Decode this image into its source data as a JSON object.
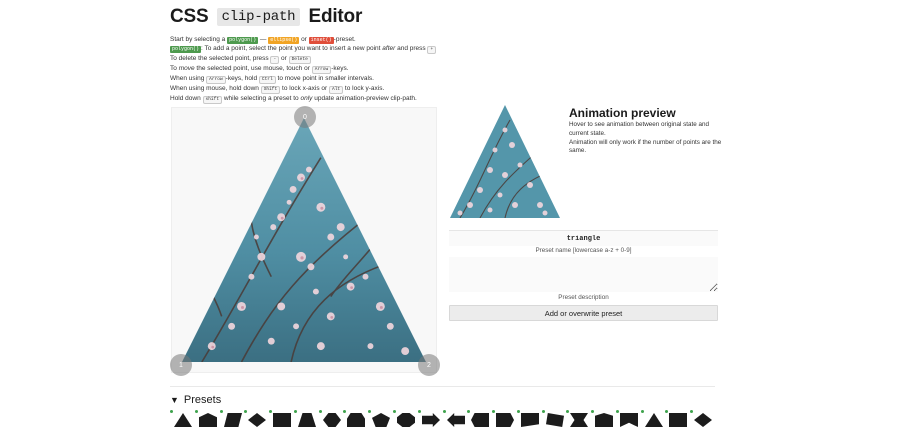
{
  "header": {
    "title_pre": "CSS",
    "title_code": "clip-path",
    "title_post": "Editor"
  },
  "instructions": {
    "l1_a": "Start by selecting a",
    "tag_polygon": "polygon()",
    "l1_b": "—",
    "tag_ellipse": "ellipse()",
    "l1_c": "or",
    "tag_inset": "inset()",
    "l1_d": "-preset.",
    "l2_tag": "polygon()",
    "l2_a": ": To add a point, select the point you want to insert a new point",
    "l2_em": "after",
    "l2_b": "and press",
    "l2_key": "+",
    "l3_a": "To delete the selected point, press",
    "l3_key1": "-",
    "l3_b": "or",
    "l3_key2": "Delete",
    "l4_a": "To",
    "l4_em": "move",
    "l4_b": "the selected point, use mouse, touch or",
    "l4_key": "Arrow",
    "l4_c": "-keys.",
    "l5_a": "When using",
    "l5_key1": "Arrow",
    "l5_b": "-keys, hold",
    "l5_key2": "Ctrl",
    "l5_c": "to move point in smaller intervals.",
    "l6_a": "When using mouse, hold down",
    "l6_key1": "Shift",
    "l6_b": "to lock x-axis or",
    "l6_key2": "Alt",
    "l6_c": "to lock y-axis.",
    "l7_a": "Hold down",
    "l7_key": "shift",
    "l7_b": "while selecting a preset to",
    "l7_em": "only",
    "l7_c": "update animation-preview clip-path."
  },
  "editor": {
    "handles": [
      "0",
      "1",
      "2"
    ]
  },
  "animation": {
    "title": "Animation preview",
    "desc1": "Hover to see animation between original state and current state.",
    "desc2": "Animation will only work if the number of points are the same."
  },
  "form": {
    "preset_name_value": "triangle",
    "preset_name_label": "Preset name [lowercase a-z + 0-9]",
    "preset_desc_value": "",
    "preset_desc_label": "Preset description",
    "add_button": "Add or overwrite preset"
  },
  "presets": {
    "label": "Presets",
    "toggle_icon": "triangle-down-icon"
  },
  "colors": {
    "polygon_tag": "#4e9a4e",
    "ellipse_tag": "#f1a424",
    "inset_tag": "#e04e3a",
    "handle": "#8a8a8a"
  }
}
